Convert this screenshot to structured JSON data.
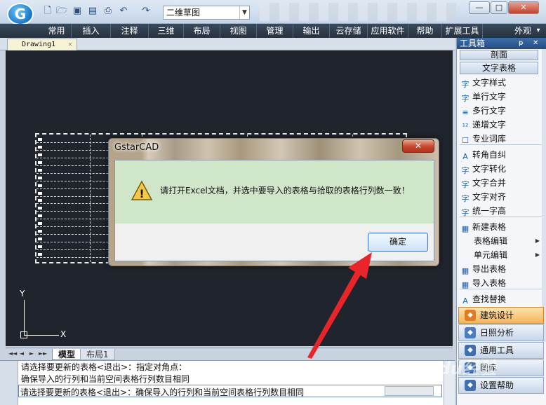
{
  "app": {
    "logo_letter": "G",
    "workspace": "二维草图"
  },
  "quick_access_icons": [
    "new-file-icon",
    "open-folder-icon",
    "save-icon",
    "save-as-icon",
    "print-icon",
    "undo-icon",
    "redo-icon"
  ],
  "window_controls": {
    "minimize": "—",
    "restore": "□",
    "close": "✕"
  },
  "menu": {
    "items": [
      "常用",
      "插入",
      "注释",
      "三维",
      "布局",
      "视图",
      "管理",
      "输出",
      "云存储",
      "应用软件",
      "帮助",
      "扩展工具"
    ],
    "appearance": "外观",
    "appearance_arrow": "▾"
  },
  "document_tab": {
    "name": "Drawing1",
    "close": "✕"
  },
  "layout_tabs": {
    "model": "模型",
    "layout1": "布局1",
    "nav": [
      "◄◄",
      "◄",
      "►",
      "►►"
    ]
  },
  "ucs": {
    "x": "X",
    "y": "Y"
  },
  "command_lines": [
    "请选择要更新的表格<退出>：指定对角点：",
    "确保导入的行列和当前空间表格行列数目相同",
    "请选择要更新的表格<退出>：确保导入的行列和当前空间表格行列数目相同"
  ],
  "toolbox": {
    "title": "工具箱",
    "pin": "ᵽ",
    "close": "✕",
    "categories": [
      "剖面",
      "文字表格"
    ],
    "items": [
      {
        "label": "文字样式",
        "icon": "text-style-icon",
        "glyph": "字"
      },
      {
        "label": "单行文字",
        "icon": "single-line-text-icon",
        "glyph": "字"
      },
      {
        "label": "多行文字",
        "icon": "multiline-text-icon",
        "glyph": "≡"
      },
      {
        "label": "递增文字",
        "icon": "increment-text-icon",
        "glyph": "¹²"
      },
      {
        "label": "专业词库",
        "icon": "dictionary-icon",
        "glyph": "☐"
      },
      {
        "label": "转角自纠",
        "icon": "corner-text-icon",
        "glyph": "A"
      },
      {
        "label": "文字转化",
        "icon": "text-convert-icon",
        "glyph": "字"
      },
      {
        "label": "文字合并",
        "icon": "text-merge-icon",
        "glyph": "字"
      },
      {
        "label": "文字对齐",
        "icon": "text-align-icon",
        "glyph": "字"
      },
      {
        "label": "统一字高",
        "icon": "text-height-icon",
        "glyph": "字"
      },
      {
        "label": "新建表格",
        "icon": "new-table-icon",
        "glyph": "▦"
      },
      {
        "label": "表格编辑",
        "icon": "",
        "glyph": ""
      },
      {
        "label": "单元编辑",
        "icon": "",
        "glyph": ""
      },
      {
        "label": "导出表格",
        "icon": "export-table-icon",
        "glyph": "▦"
      },
      {
        "label": "导入表格",
        "icon": "import-table-icon",
        "glyph": "▦"
      },
      {
        "label": "查找替换",
        "icon": "find-replace-icon",
        "glyph": "A"
      }
    ],
    "groups": [
      {
        "label": "建筑设计",
        "icon": "building-icon",
        "color": "#e07b24"
      },
      {
        "label": "日照分析",
        "icon": "sunlight-icon",
        "color": "#4a7cc4"
      },
      {
        "label": "通用工具",
        "icon": "tools-icon",
        "color": "#3f6fb2"
      },
      {
        "label": "图库",
        "icon": "gallery-icon",
        "color": "#3f6fb2"
      },
      {
        "label": "设置帮助",
        "icon": "help-icon",
        "color": "#3f6fb2"
      }
    ]
  },
  "dialog": {
    "title": "GstarCAD",
    "close": "✕",
    "message": "请打开Excel文档，并选中要导入的表格与拾取的表格行列数一致！",
    "ok": "确定",
    "warn_glyph": "!"
  },
  "colors": {
    "canvas": "#20242c",
    "dialog_message_bg": "#cfe6c9",
    "annotation_arrow": "#e8262a",
    "menubar": "#2e3b4c"
  },
  "watermark": "Baidu经验"
}
